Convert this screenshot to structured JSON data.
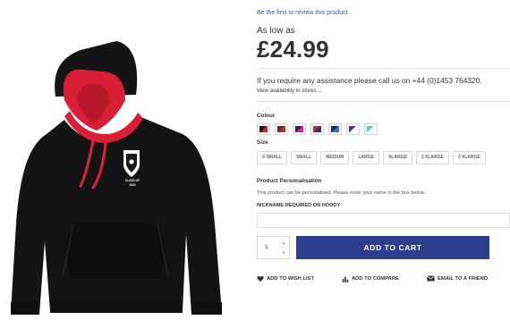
{
  "product": {
    "review_link": "Be the first to review this product",
    "price_prefix": "As low as",
    "price": "£24.99",
    "assistance_text": "If you require any assistance please call us on +44 (0)1453 764320.",
    "stores_link": "View availability in stores ..."
  },
  "colour": {
    "label": "Colour",
    "swatches": [
      {
        "name": "black-red",
        "a": "#1a1a1a",
        "b": "#d11f2e"
      },
      {
        "name": "brown-red",
        "a": "#5b2a1d",
        "b": "#b8312a"
      },
      {
        "name": "navy-pink",
        "a": "#1d2463",
        "b": "#e0208c"
      },
      {
        "name": "red-navy",
        "a": "#c8262f",
        "b": "#2b2f66"
      },
      {
        "name": "navy-blue",
        "a": "#1c2a6c",
        "b": "#4368c9"
      },
      {
        "name": "purple-white",
        "a": "#5a2a8f",
        "b": "#ffffff"
      },
      {
        "name": "mint-white",
        "a": "#4ed6c2",
        "b": "#ffffff"
      }
    ]
  },
  "size": {
    "label": "Size",
    "options": [
      "X SMALL",
      "SMALL",
      "MEDIUM",
      "LARGE",
      "XLARGE",
      "2 XLARGE",
      "3 XLARGE"
    ]
  },
  "personalisation": {
    "title": "Product Personalisation",
    "text": "This product can be personalised. Please enter your name in the box below.",
    "nickname_label": "NICKNAME REQUIRED ON HOODY",
    "nickname_value": ""
  },
  "cart": {
    "quantity": "1",
    "add_to_cart": "ADD TO CART"
  },
  "actions": {
    "wish_list": "ADD TO WISH LIST",
    "compare": "ADD TO COMPARE",
    "email": "EMAIL TO A FRIEND"
  },
  "hoodie_badge": {
    "line1": "CLASS OF",
    "line2": "2024"
  }
}
